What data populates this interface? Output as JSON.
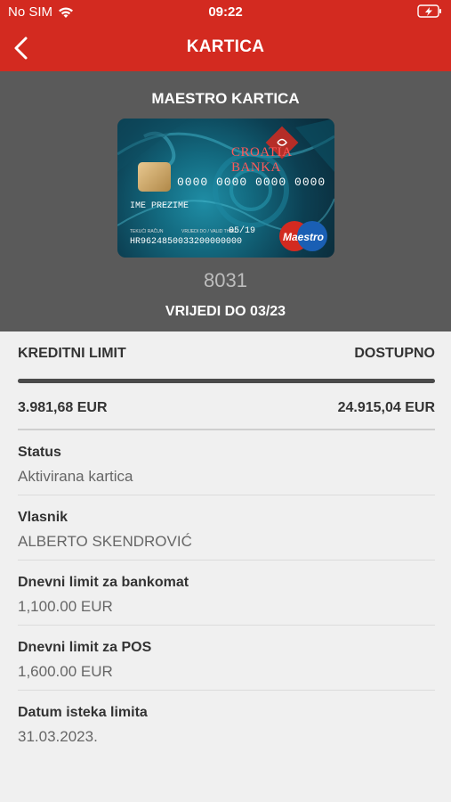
{
  "status_bar": {
    "carrier": "No SIM",
    "time": "09:22",
    "icons": [
      "wifi-icon",
      "battery-charging-icon"
    ]
  },
  "nav": {
    "back_icon": "chevron-left-icon",
    "title": "KARTICA"
  },
  "card": {
    "name": "MAESTRO KARTICA",
    "bank_name": "CROATIA  BANKA",
    "number": "0000 0000 0000 0000",
    "holder": "IME PREZIME",
    "account_label": "TEKUĆI RAČUN",
    "valid_label": "VRIJEDI DO / VALID THRU",
    "valid_thru": "05/19",
    "iban": "HR9624850033200000000",
    "brand": "Maestro",
    "last_digits": "8031",
    "valid_to": "VRIJEDI DO 03/23"
  },
  "limits": {
    "credit_label": "KREDITNI LIMIT",
    "available_label": "DOSTUPNO",
    "credit_value": "3.981,68 EUR",
    "available_value": "24.915,04 EUR",
    "progress_fraction": 1.0
  },
  "details": [
    {
      "label": "Status",
      "value": "Aktivirana kartica"
    },
    {
      "label": "Vlasnik",
      "value": "ALBERTO SKENDROVIĆ"
    },
    {
      "label": "Dnevni limit za bankomat",
      "value": "1,100.00 EUR"
    },
    {
      "label": "Dnevni limit za POS",
      "value": "1,600.00 EUR"
    },
    {
      "label": "Datum isteka limita",
      "value": "31.03.2023."
    }
  ],
  "colors": {
    "header_red": "#d32a20",
    "card_panel_gray": "#5a5a5a",
    "background": "#f0f0f0"
  }
}
